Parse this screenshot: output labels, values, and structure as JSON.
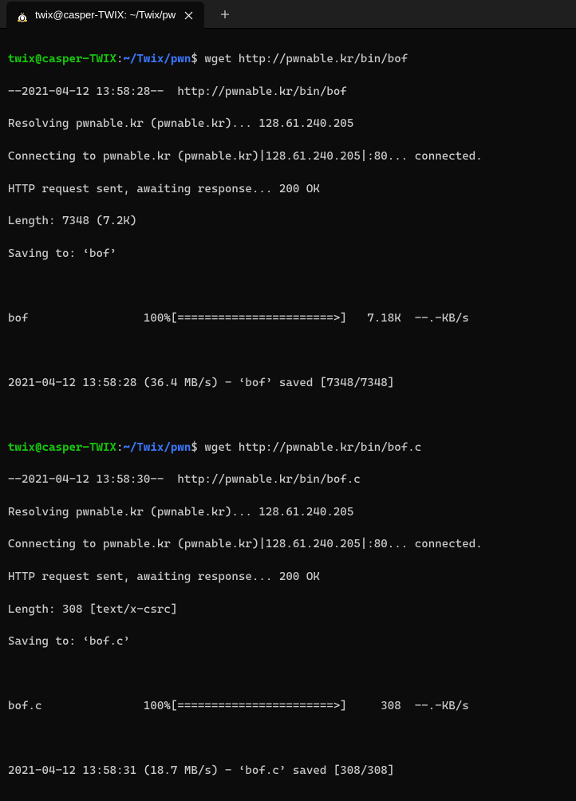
{
  "tab": {
    "title": "twix@casper-TWIX: ~/Twix/pw"
  },
  "prompt": {
    "user": "twix@casper-TWIX",
    "path": "~/Twix/pwn",
    "sep1": ":",
    "sep2": "$"
  },
  "block1": {
    "cmd": "wget http://pwnable.kr/bin/bof",
    "l1": "--2021-04-12 13:58:28--  http://pwnable.kr/bin/bof",
    "l2": "Resolving pwnable.kr (pwnable.kr)... 128.61.240.205",
    "l3": "Connecting to pwnable.kr (pwnable.kr)|128.61.240.205|:80... connected.",
    "l4": "HTTP request sent, awaiting response... 200 OK",
    "l5": "Length: 7348 (7.2K)",
    "l6": "Saving to: ‘bof’",
    "progress": "bof                 100%[=======================>]   7.18K  --.-KB/s",
    "saved": "2021-04-12 13:58:28 (36.4 MB/s) - ‘bof’ saved [7348/7348]"
  },
  "block2": {
    "cmd": "wget http://pwnable.kr/bin/bof.c",
    "l1": "--2021-04-12 13:58:30--  http://pwnable.kr/bin/bof.c",
    "l2": "Resolving pwnable.kr (pwnable.kr)... 128.61.240.205",
    "l3": "Connecting to pwnable.kr (pwnable.kr)|128.61.240.205|:80... connected.",
    "l4": "HTTP request sent, awaiting response... 200 OK",
    "l5": "Length: 308 [text/x-csrc]",
    "l6": "Saving to: ‘bof.c’",
    "progress": "bof.c               100%[=======================>]     308  --.-KB/s",
    "saved": "2021-04-12 13:58:31 (18.7 MB/s) - ‘bof.c’ saved [308/308]"
  }
}
